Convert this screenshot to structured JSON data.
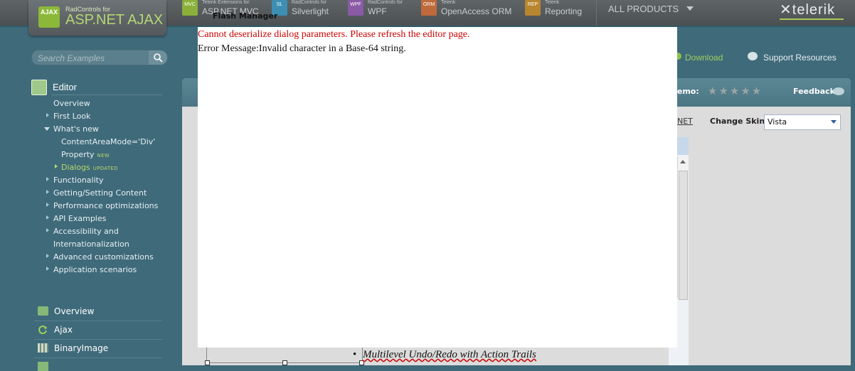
{
  "header": {
    "logo_small": "RadControls for",
    "logo_big": "ASP.NET AJAX",
    "logo_badge": "AJAX",
    "products": [
      {
        "badge": "MVC",
        "small": "Telerik Extensions for",
        "name": "ASP.NET MVC",
        "color": "#8ab03a"
      },
      {
        "badge": "SL",
        "small": "RadControls for",
        "name": "Silverlight",
        "color": "#3c8fb3"
      },
      {
        "badge": "WPF",
        "small": "RadControls for",
        "name": "WPF",
        "color": "#8a5aa5"
      },
      {
        "badge": "ORM",
        "small": "Telerik",
        "name": "OpenAccess ORM",
        "color": "#c06a3c"
      },
      {
        "badge": "REP",
        "small": "Telerik",
        "name": "Reporting",
        "color": "#b8862e"
      }
    ],
    "all_products": "ALL PRODUCTS",
    "brand": "telerik"
  },
  "search": {
    "placeholder": "Search Examples"
  },
  "sidebar": {
    "section_title": "Editor",
    "items": [
      {
        "label": "Overview"
      },
      {
        "label": "First Look"
      },
      {
        "label": "What's new"
      },
      {
        "label": "ContentAreaMode='Div'"
      },
      {
        "label": "Property"
      },
      {
        "label": "Dialogs"
      },
      {
        "label": "Functionality"
      },
      {
        "label": "Getting/Setting Content"
      },
      {
        "label": "Performance optimizations"
      },
      {
        "label": "API Examples"
      },
      {
        "label": "Accessibility and"
      },
      {
        "label": "Internationalization"
      },
      {
        "label": "Advanced customizations"
      },
      {
        "label": "Application scenarios"
      }
    ],
    "tag_new": "NEW",
    "tag_updated": "UPDATED",
    "bottom_items": [
      {
        "label": "Overview"
      },
      {
        "label": "Ajax"
      },
      {
        "label": "BinaryImage"
      }
    ]
  },
  "links": {
    "download": "Download",
    "support": "Support Resources"
  },
  "demo": {
    "rate_label": "demo:",
    "stars": "★★★★★",
    "feedback": "Feedback",
    "net_link": "NET",
    "change_skin_label": "Change Skin:",
    "skin_value": "Vista",
    "bullet_text": "Multilevel Undo/Redo with Action Trails"
  },
  "dialog": {
    "title": "Flash Manager",
    "error_line": "Cannot deserialize dialog parameters. Please refresh the editor page.",
    "error_message": "Error Message:Invalid character in a Base-64 string."
  }
}
